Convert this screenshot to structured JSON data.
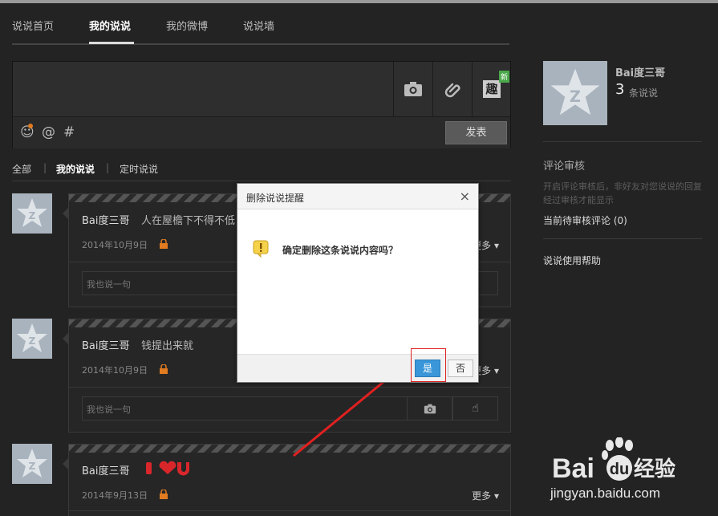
{
  "nav": {
    "items": [
      "说说首页",
      "我的说说",
      "我的微博",
      "说说墙"
    ],
    "active_index": 1
  },
  "composer": {
    "publish_label": "发表",
    "new_badge": "新",
    "fun_label": "趣",
    "icons": [
      "camera-icon",
      "link-icon",
      "fun-icon",
      "emoji-icon",
      "at-icon",
      "hashtag-icon"
    ]
  },
  "filters": {
    "items": [
      "全部",
      "我的说说",
      "定时说说"
    ],
    "active_index": 1
  },
  "posts": [
    {
      "author": "Bai度三哥",
      "content": "人在屋檐下不得不低",
      "date": "2014年10月9日",
      "more": "更多",
      "reply_placeholder": "我也说一句"
    },
    {
      "author": "Bai度三哥",
      "content": "钱提出来就",
      "date": "2014年10月9日",
      "more": "更多",
      "reply_placeholder": "我也说一句"
    },
    {
      "author": "Bai度三哥",
      "content": "",
      "date": "2014年9月13日",
      "more": "更多",
      "reply_placeholder": ""
    }
  ],
  "side": {
    "name": "Bai度三哥",
    "count": "3",
    "count_label": "条说说",
    "review_heading": "评论审核",
    "review_desc": "开启评论审核后，非好友对您说说的回复经过审核才能显示",
    "pending_review": "当前待审核评论 (0)",
    "help": "说说使用帮助"
  },
  "dialog": {
    "title": "删除说说提醒",
    "close": "×",
    "message": "确定删除这条说说内容吗？",
    "yes": "是",
    "no": "否"
  },
  "watermark": {
    "brand_left": "Bai",
    "brand_mid": "du",
    "brand_right": "经验",
    "url": "jingyan.baidu.com"
  },
  "colors": {
    "background": "#232323",
    "accent_blue": "#3a96d8",
    "highlight_red": "#e02020",
    "lock_orange": "#e07b20",
    "badge_green": "#4aa84a"
  }
}
